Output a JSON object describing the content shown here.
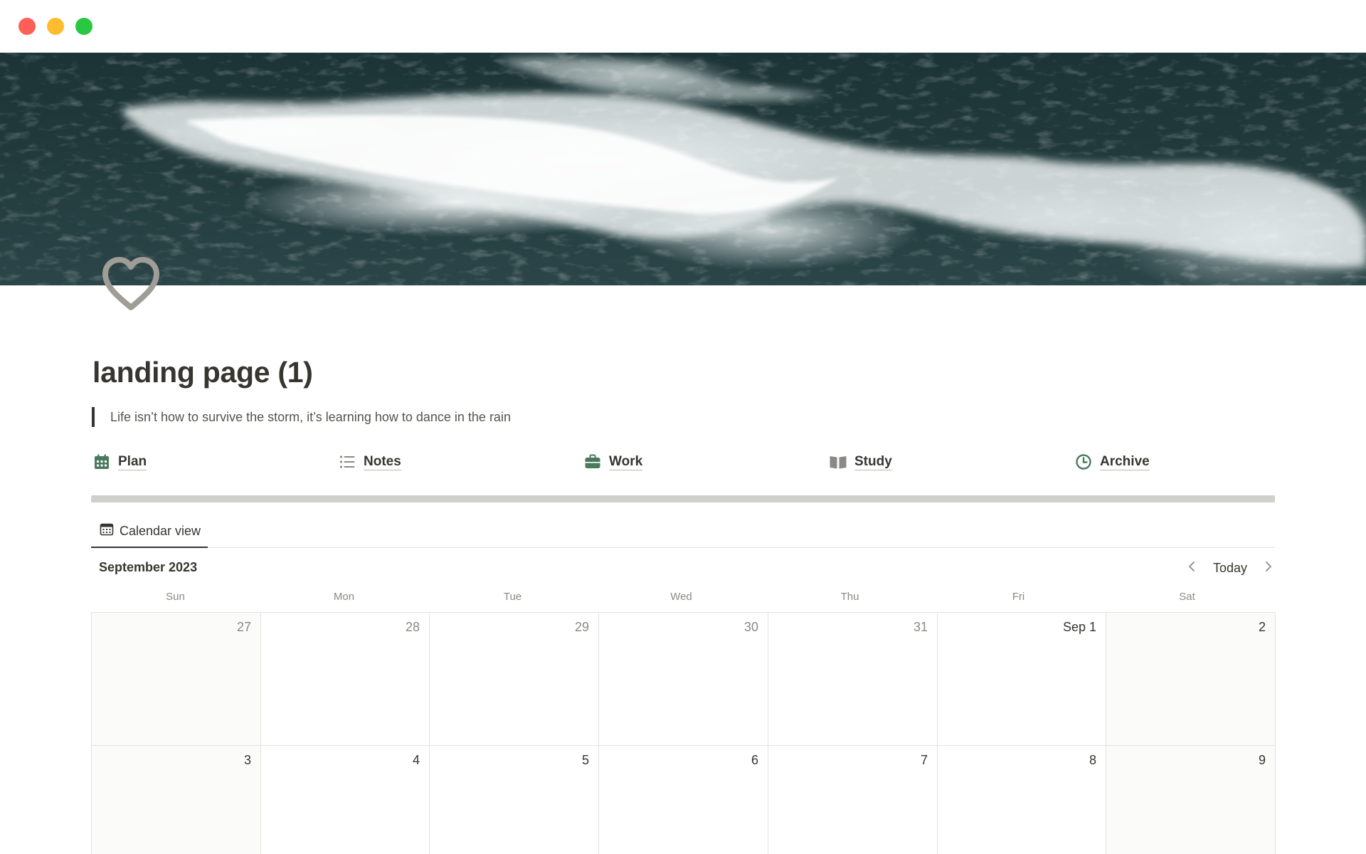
{
  "window": {
    "controls": [
      "close",
      "minimize",
      "maximize"
    ]
  },
  "page": {
    "icon": "heart-icon",
    "title": "landing page (1)",
    "quote": "Life isn’t how to survive the storm, it’s learning how to dance in the rain"
  },
  "nav": [
    {
      "label": "Plan",
      "icon": "calendar-grid-icon",
      "color": "#4a7a5e"
    },
    {
      "label": "Notes",
      "icon": "list-icon",
      "color": "#8a8985"
    },
    {
      "label": "Work",
      "icon": "briefcase-icon",
      "color": "#4a7a5e"
    },
    {
      "label": "Study",
      "icon": "book-icon",
      "color": "#8a8985"
    },
    {
      "label": "Archive",
      "icon": "clock-icon",
      "color": "#4a7a5e"
    }
  ],
  "view": {
    "tab_label": "Calendar view",
    "tab_icon": "calendar-icon"
  },
  "calendar": {
    "month_label": "September 2023",
    "today_label": "Today",
    "weekdays": [
      "Sun",
      "Mon",
      "Tue",
      "Wed",
      "Thu",
      "Fri",
      "Sat"
    ],
    "weeks": [
      [
        {
          "label": "27",
          "current": false
        },
        {
          "label": "28",
          "current": false
        },
        {
          "label": "29",
          "current": false
        },
        {
          "label": "30",
          "current": false
        },
        {
          "label": "31",
          "current": false
        },
        {
          "label": "Sep 1",
          "current": true
        },
        {
          "label": "2",
          "current": true
        }
      ],
      [
        {
          "label": "3",
          "current": true
        },
        {
          "label": "4",
          "current": true
        },
        {
          "label": "5",
          "current": true
        },
        {
          "label": "6",
          "current": true
        },
        {
          "label": "7",
          "current": true
        },
        {
          "label": "8",
          "current": true
        },
        {
          "label": "9",
          "current": true
        }
      ]
    ]
  }
}
